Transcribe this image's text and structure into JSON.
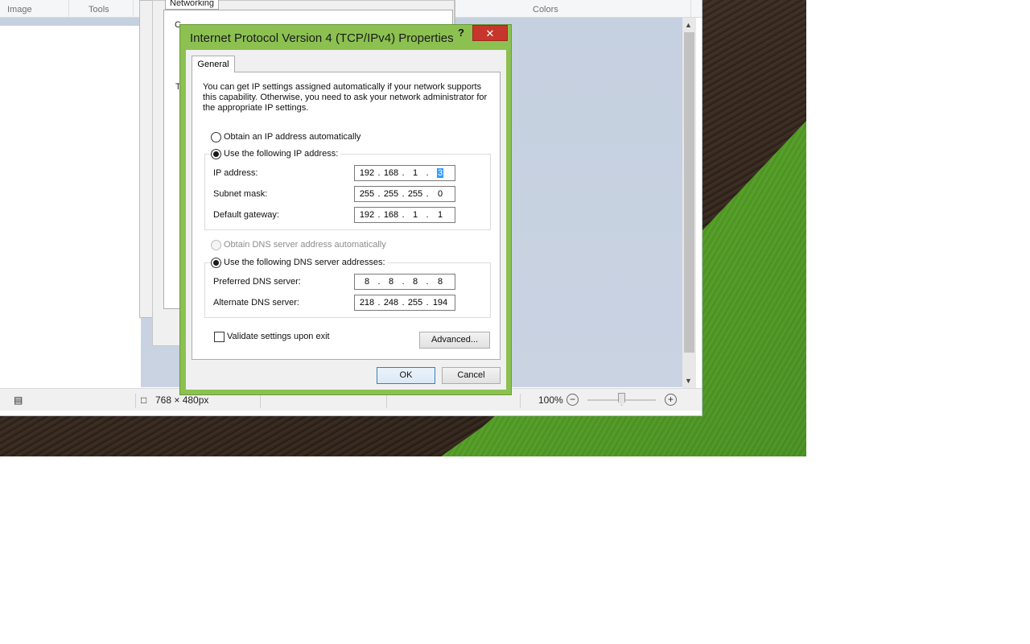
{
  "paint": {
    "ribbon_groups": [
      "Image",
      "Tools",
      "Colors"
    ],
    "status": {
      "canvas_size": "768 × 480px",
      "zoom": "100%"
    }
  },
  "background_dialog": {
    "tab": "Networking",
    "fragments": [
      "C",
      "T"
    ]
  },
  "dialog": {
    "title": "Internet Protocol Version 4 (TCP/IPv4) Properties",
    "help": "?",
    "close": "✕",
    "tab": "General",
    "intro": "You can get IP settings assigned automatically if your network supports this capability. Otherwise, you need to ask your network administrator for the appropriate IP settings.",
    "ip_auto_label": "Obtain an IP address automatically",
    "ip_manual_label": "Use the following IP address:",
    "fields": {
      "ip_label": "IP address:",
      "ip": [
        "192",
        "168",
        "1",
        "3"
      ],
      "subnet_label": "Subnet mask:",
      "subnet": [
        "255",
        "255",
        "255",
        "0"
      ],
      "gateway_label": "Default gateway:",
      "gateway": [
        "192",
        "168",
        "1",
        "1"
      ]
    },
    "dns_auto_label": "Obtain DNS server address automatically",
    "dns_manual_label": "Use the following DNS server addresses:",
    "dns": {
      "preferred_label": "Preferred DNS server:",
      "preferred": [
        "8",
        "8",
        "8",
        "8"
      ],
      "alternate_label": "Alternate DNS server:",
      "alternate": [
        "218",
        "248",
        "255",
        "194"
      ]
    },
    "validate_label": "Validate settings upon exit",
    "advanced_label": "Advanced...",
    "ok_label": "OK",
    "cancel_label": "Cancel"
  }
}
